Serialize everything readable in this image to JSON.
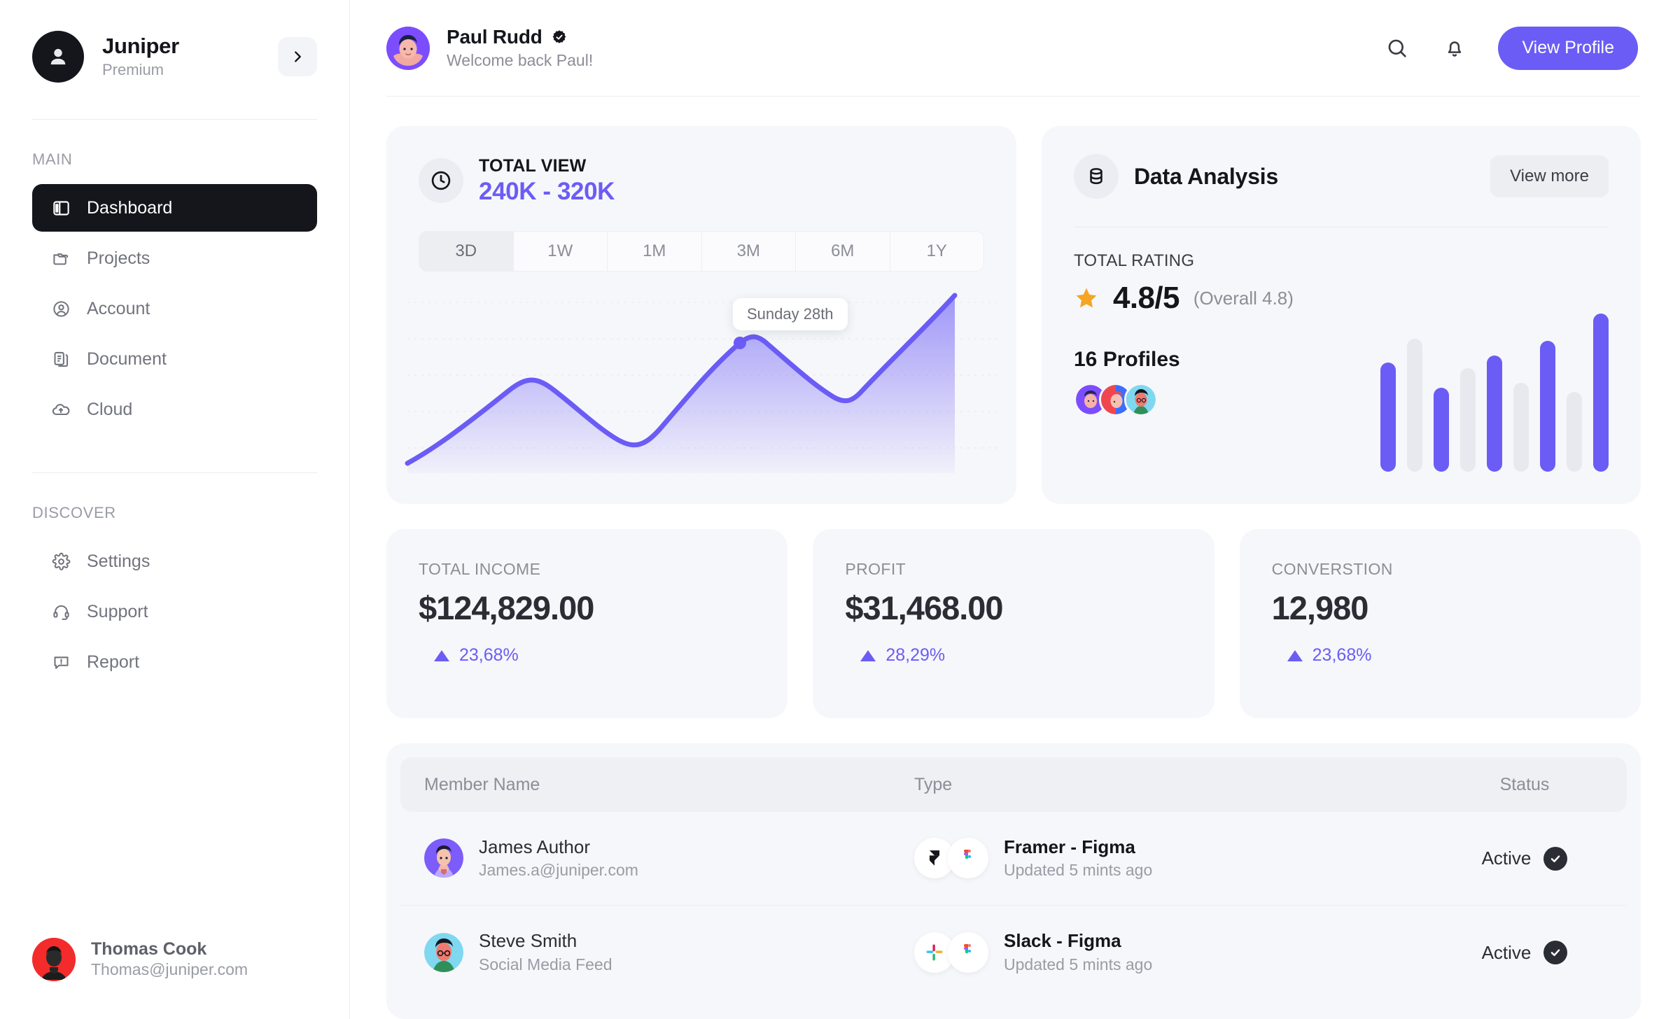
{
  "sidebar": {
    "brand": {
      "name": "Juniper",
      "plan": "Premium",
      "expand_icon": "chevron-right-icon"
    },
    "sections": [
      {
        "label": "MAIN",
        "items": [
          {
            "label": "Dashboard",
            "icon": "layout-panel-icon",
            "active": true
          },
          {
            "label": "Projects",
            "icon": "folders-icon",
            "active": false
          },
          {
            "label": "Account",
            "icon": "user-circle-icon",
            "active": false
          },
          {
            "label": "Document",
            "icon": "documents-icon",
            "active": false
          },
          {
            "label": "Cloud",
            "icon": "cloud-upload-icon",
            "active": false
          }
        ]
      },
      {
        "label": "DISCOVER",
        "items": [
          {
            "label": "Settings",
            "icon": "gear-icon",
            "active": false
          },
          {
            "label": "Support",
            "icon": "headset-icon",
            "active": false
          },
          {
            "label": "Report",
            "icon": "alert-message-icon",
            "active": false
          }
        ]
      }
    ],
    "user": {
      "name": "Thomas Cook",
      "email": "Thomas@juniper.com",
      "avatar_color": "#f42b2b"
    }
  },
  "topbar": {
    "name": "Paul Rudd",
    "verified_icon": "verified-badge-icon",
    "greeting": "Welcome back Paul!",
    "search_icon": "search-icon",
    "bell_icon": "bell-icon",
    "view_profile_label": "View Profile"
  },
  "total_view": {
    "icon": "clock-icon",
    "title": "TOTAL VIEW",
    "value": "240K - 320K",
    "ranges": [
      "3D",
      "1W",
      "1M",
      "3M",
      "6M",
      "1Y"
    ],
    "active_range": "3D",
    "tooltip": "Sunday 28th"
  },
  "data_analysis": {
    "icon": "database-icon",
    "title": "Data Analysis",
    "view_more_label": "View more",
    "rating_label": "TOTAL RATING",
    "star_icon": "star-icon",
    "rating": "4.8/5",
    "overall": "(Overall 4.8)",
    "profiles_count": "16 Profiles",
    "avatars": [
      "#7c4dff",
      "#e8484f",
      "#7fd8f0"
    ]
  },
  "stats": [
    {
      "label": "TOTAL INCOME",
      "value": "$124,829.00",
      "delta": "23,68%",
      "trend_icon": "triangle-up-icon"
    },
    {
      "label": "PROFIT",
      "value": "$31,468.00",
      "delta": "28,29%",
      "trend_icon": "triangle-up-icon"
    },
    {
      "label": "CONVERSTION",
      "value": "12,980",
      "delta": "23,68%",
      "trend_icon": "triangle-up-icon"
    }
  ],
  "table": {
    "columns": [
      "Member Name",
      "Type",
      "Status"
    ],
    "rows": [
      {
        "name": "James Author",
        "sub": "James.a@juniper.com",
        "type_name": "Framer - Figma",
        "type_sub": "Updated 5 mints ago",
        "type_logos": [
          "framer-logo-icon",
          "figma-logo-icon"
        ],
        "status": "Active",
        "status_icon": "check-circle-icon",
        "avatar_color": "#7c5cfa"
      },
      {
        "name": "Steve Smith",
        "sub": "Social Media Feed",
        "type_name": "Slack - Figma",
        "type_sub": "Updated 5 mints ago",
        "type_logos": [
          "slack-logo-icon",
          "figma-logo-icon"
        ],
        "status": "Active",
        "status_icon": "check-circle-icon",
        "avatar_color": "#7fd8f0"
      }
    ]
  },
  "colors": {
    "accent": "#6b5cf6",
    "dark": "#14161c",
    "card_bg": "#f6f7fa",
    "muted": "#8c8e97",
    "star": "#f5a524"
  },
  "chart_data": [
    {
      "type": "area",
      "title": "TOTAL VIEW",
      "x": [
        0,
        1,
        2,
        3,
        4,
        5,
        6
      ],
      "values": [
        8,
        46,
        62,
        38,
        80,
        58,
        100
      ],
      "point_labels": [
        "",
        "",
        "",
        "",
        "Sunday 28th",
        "",
        ""
      ],
      "highlight_index": 4,
      "ylim": [
        0,
        100
      ],
      "grid": true,
      "legend": "none",
      "line_color": "#6b5cf6",
      "fill": "gradient purple to transparent"
    },
    {
      "type": "bar",
      "title": "Data Analysis",
      "categories": [
        "1",
        "2",
        "3",
        "4",
        "5",
        "6",
        "7",
        "8",
        "9"
      ],
      "values": [
        60,
        73,
        46,
        57,
        64,
        49,
        72,
        44,
        87
      ],
      "colors": [
        "#6b5cf6",
        "#e7e9ee",
        "#6b5cf6",
        "#e7e9ee",
        "#6b5cf6",
        "#e7e9ee",
        "#6b5cf6",
        "#e7e9ee",
        "#6b5cf6"
      ],
      "ylim": [
        0,
        100
      ],
      "grid": false,
      "legend": "none"
    }
  ]
}
